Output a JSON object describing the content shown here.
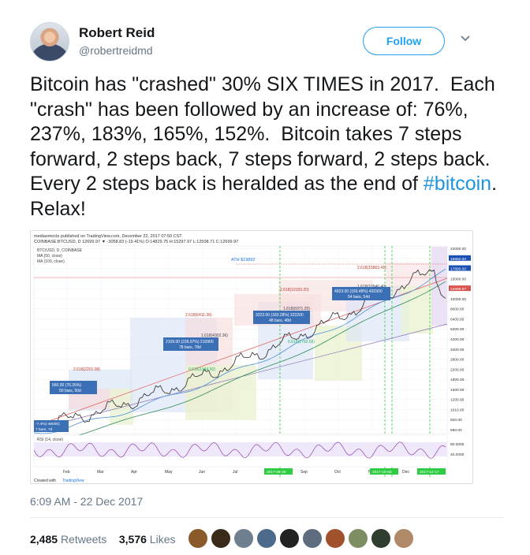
{
  "user": {
    "display_name": "Robert Reid",
    "handle": "@robertreidmd",
    "follow_label": "Follow"
  },
  "tweet": {
    "text_before": "Bitcoin has \"crashed\" 30% SIX TIMES in 2017.  Each \"crash\" has been followed by an increase of: 76%, 237%, 183%, 165%, 152%.  Bitcoin takes 7 steps forward, 2 steps back, 7 steps forward, 2 steps back.  Every 2 steps back is heralded as the end of ",
    "hashtag": "#bitcoin",
    "text_after": ".  Relax!"
  },
  "chart": {
    "header_line1": "mediasmocle published on TradingView.com, December 22, 2017 07:50 CST",
    "header_line2": "COINBASE:BTCUSD, D 12699.97 ▼ -3058.83 (-19.41%) O:14829.75 H:15297.97 L:12508.71 C:12699.97",
    "legend": [
      "BTC/USD, D, COINBASE",
      "MA (50, close)",
      "MA (100, close)"
    ],
    "ath_label": "ATH $19892",
    "rsi_label": "RSI (14, close)",
    "footer": "Created with",
    "footer_brand": "TradingView",
    "price_axis": [
      "22000.00",
      "19892.00",
      "17890.00",
      "15000.00",
      "12699.97",
      "10000.00",
      "8000.00",
      "6400.00",
      "5200.00",
      "4200.00",
      "3400.00",
      "2800.00",
      "2200.00",
      "1800.00",
      "1500.00",
      "1200.00",
      "1010.00",
      "820.00",
      "680.00"
    ],
    "rsi_axis": [
      "80.0000",
      "40.0000"
    ],
    "months": [
      "Feb",
      "Mar",
      "Apr",
      "May",
      "Jun",
      "Jul",
      "Aug",
      "Sep",
      "Oct",
      "Nov",
      "Dec"
    ],
    "date_badges": [
      "2017-08-20",
      "2017-10-03",
      "2017-12-17"
    ],
    "fib_labels": [
      "2.618(2201.08)",
      "2.618(6411.36)",
      "1.618(4302.36)",
      "1.618(6971.20)",
      "2.618(10193.20)",
      "2.618(15863.41)",
      "1.618(10940.40)",
      "0.618(1793.03)",
      "0.618(1944.50)"
    ],
    "boxes": [
      {
        "l1": "560.00 (76.35%)",
        "l2": "50 bars, 50d"
      },
      {
        "l1": "2109.00 (236.97%) 210900",
        "l2": "78 bars, 78d"
      },
      {
        "l1": "3222.00 (183.28%) 322200",
        "l2": "48 bars, 48d"
      },
      {
        "l1": "4923.00 (165.48%) 492300",
        "l2": "54 bars, 54d"
      }
    ],
    "drop_label": "-7.4%(-46000)",
    "drop_sub": "7 bars, 7d"
  },
  "meta": {
    "timestamp": "6:09 AM - 22 Dec 2017",
    "retweets_count": "2,485",
    "retweets_label": "Retweets",
    "likes_count": "3,576",
    "likes_label": "Likes"
  },
  "colors": {
    "accent": "#1da1f2",
    "ma50": "#4a90d9",
    "ma100": "#2e8b57",
    "uptrend": "#e05757"
  }
}
